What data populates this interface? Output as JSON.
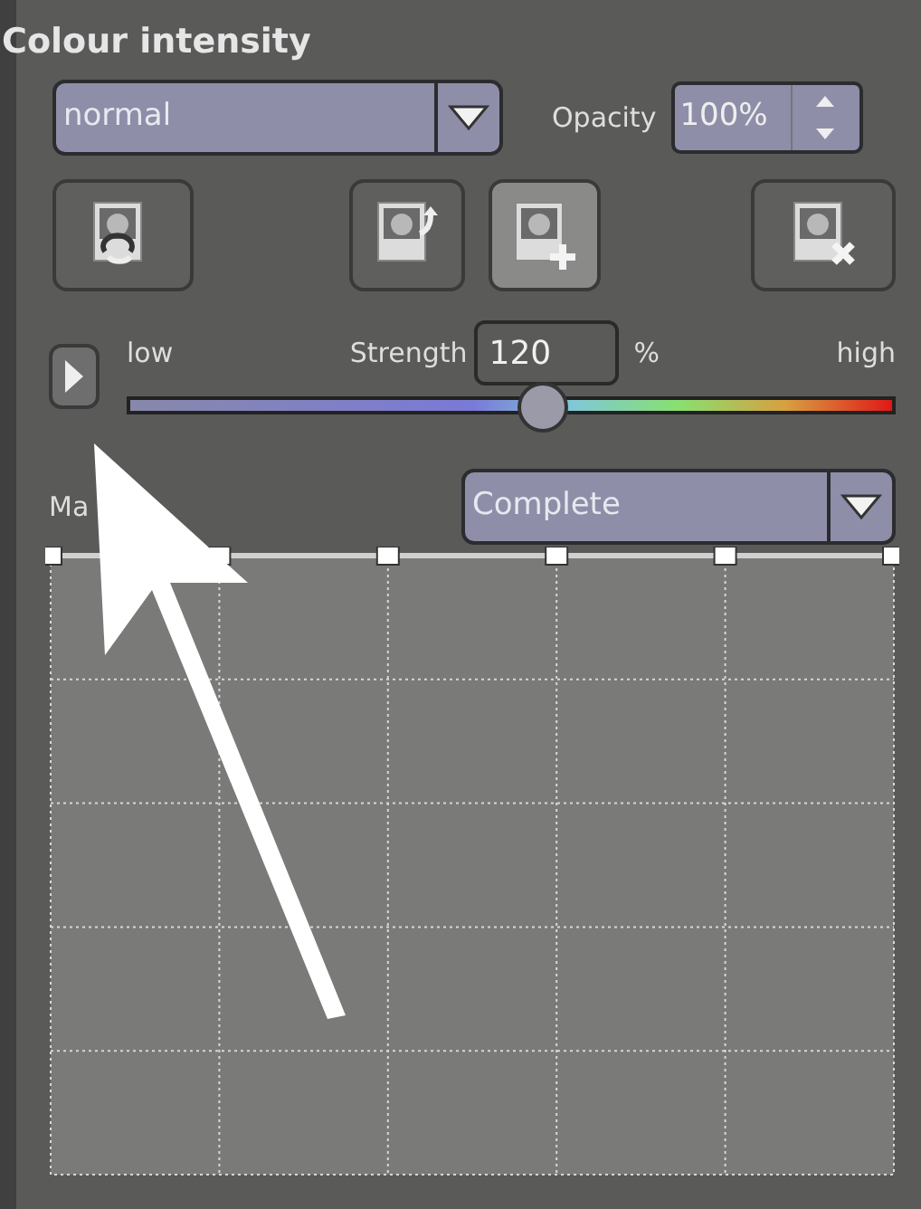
{
  "panel": {
    "title": "Colour intensity"
  },
  "blend_mode": {
    "value": "normal"
  },
  "opacity": {
    "label": "Opacity",
    "value": "100%"
  },
  "tool_buttons": [
    {
      "kind": "refresh",
      "active": false
    },
    {
      "kind": "export",
      "active": false
    },
    {
      "kind": "add",
      "active": true
    },
    {
      "kind": "delete",
      "active": false
    }
  ],
  "strength": {
    "low_label": "low",
    "label": "Strength",
    "value": "120",
    "unit": "%",
    "high_label": "high",
    "level": 0.54
  },
  "masking": {
    "label": "Ma",
    "value": "Complete"
  }
}
